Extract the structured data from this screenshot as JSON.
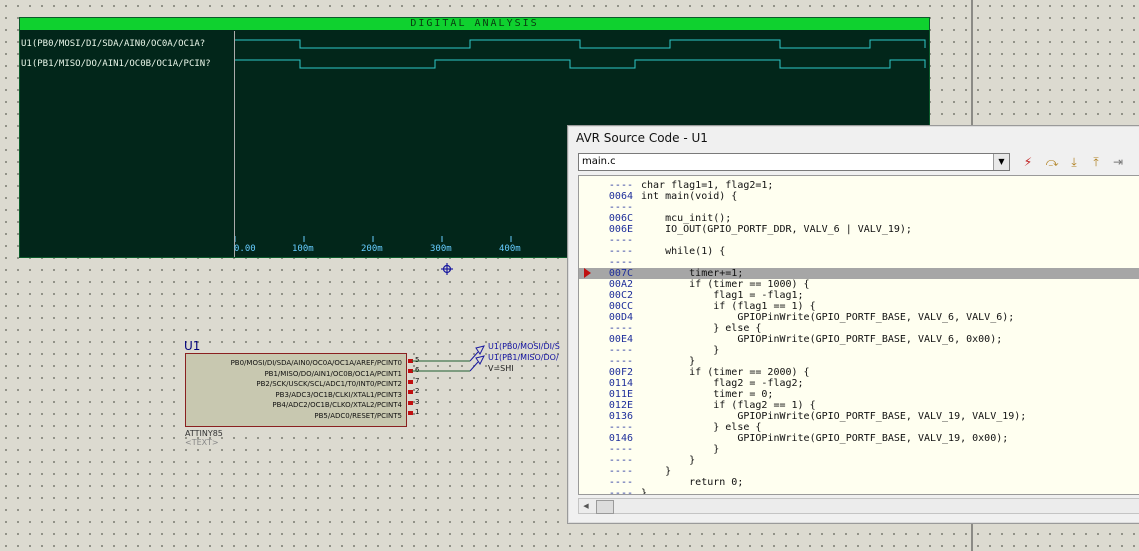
{
  "analysis": {
    "title": "DIGITAL ANALYSIS",
    "signals": [
      {
        "label": "U1(PB0/MOSI/DI/SDA/AIN0/OC0A/OC1A?",
        "transitions": [
          0,
          65,
          235,
          345,
          435,
          545,
          635,
          760
        ]
      },
      {
        "label": "U1(PB1/MISO/DO/AIN1/OC0B/OC1A/PCIN?",
        "transitions": [
          0,
          65,
          200,
          335,
          400,
          545,
          655,
          780
        ]
      }
    ],
    "time_ticks": [
      "0.00",
      "100m",
      "200m",
      "300m",
      "400m"
    ],
    "signal_color": "#2ec8c8",
    "tick_color": "#66ccff"
  },
  "component": {
    "ref": "U1",
    "part": "ATTINY85",
    "text": "<TEXT>",
    "pins": [
      {
        "label": "PB0/MOSI/DI/SDA/AIN0/OC0A/OC1A/AREF/PCINT0",
        "num": "5"
      },
      {
        "label": "PB1/MISO/DO/AIN1/OC0B/OC1A/PCINT1",
        "num": "6"
      },
      {
        "label": "PB2/SCK/USCK/SCL/ADC1/T0/INT0/PCINT2",
        "num": "7"
      },
      {
        "label": "PB3/ADC3/OC1B/CLKI/XTAL1/PCINT3",
        "num": "2"
      },
      {
        "label": "PB4/ADC2/OC1B/CLKO/XTAL2/PCINT4",
        "num": "3"
      },
      {
        "label": "PB5/ADC0/RESET/PCINT5",
        "num": "1"
      }
    ],
    "probe1": "U1(PB0/MOSI/DI/S",
    "probe2": "U1(PB1/MISO/DO/",
    "probe3": "V=SHI"
  },
  "avr_window": {
    "title": "AVR Source Code - U1",
    "file": "main.c",
    "toolbar_icons": [
      "run-to-cursor-icon",
      "step-over-icon",
      "step-into-icon",
      "step-out-icon",
      "toggle-breakpoint-icon"
    ],
    "current_line_index": 8,
    "lines": [
      {
        "addr": "----",
        "code": "char flag1=1, flag2=1;"
      },
      {
        "addr": "0064",
        "code": "int main(void) {"
      },
      {
        "addr": "----",
        "code": ""
      },
      {
        "addr": "006C",
        "code": "    mcu_init();"
      },
      {
        "addr": "006E",
        "code": "    IO_OUT(GPIO_PORTF_DDR, VALV_6 | VALV_19);"
      },
      {
        "addr": "----",
        "code": ""
      },
      {
        "addr": "----",
        "code": "    while(1) {"
      },
      {
        "addr": "----",
        "code": ""
      },
      {
        "addr": "007C",
        "code": "        timer+=1;"
      },
      {
        "addr": "00A2",
        "code": "        if (timer == 1000) {"
      },
      {
        "addr": "00C2",
        "code": "            flag1 = -flag1;"
      },
      {
        "addr": "00CC",
        "code": "            if (flag1 == 1) {"
      },
      {
        "addr": "00D4",
        "code": "                GPIOPinWrite(GPIO_PORTF_BASE, VALV_6, VALV_6);"
      },
      {
        "addr": "----",
        "code": "            } else {"
      },
      {
        "addr": "00E4",
        "code": "                GPIOPinWrite(GPIO_PORTF_BASE, VALV_6, 0x00);"
      },
      {
        "addr": "----",
        "code": "            }"
      },
      {
        "addr": "----",
        "code": "        }"
      },
      {
        "addr": "00F2",
        "code": "        if (timer == 2000) {"
      },
      {
        "addr": "0114",
        "code": "            flag2 = -flag2;"
      },
      {
        "addr": "011E",
        "code": "            timer = 0;"
      },
      {
        "addr": "012E",
        "code": "            if (flag2 == 1) {"
      },
      {
        "addr": "0136",
        "code": "                GPIOPinWrite(GPIO_PORTF_BASE, VALV_19, VALV_19);"
      },
      {
        "addr": "----",
        "code": "            } else {"
      },
      {
        "addr": "0146",
        "code": "                GPIOPinWrite(GPIO_PORTF_BASE, VALV_19, 0x00);"
      },
      {
        "addr": "----",
        "code": "            }"
      },
      {
        "addr": "----",
        "code": "        }"
      },
      {
        "addr": "----",
        "code": "    }"
      },
      {
        "addr": "----",
        "code": "        return 0;"
      },
      {
        "addr": "----",
        "code": "}"
      }
    ]
  }
}
